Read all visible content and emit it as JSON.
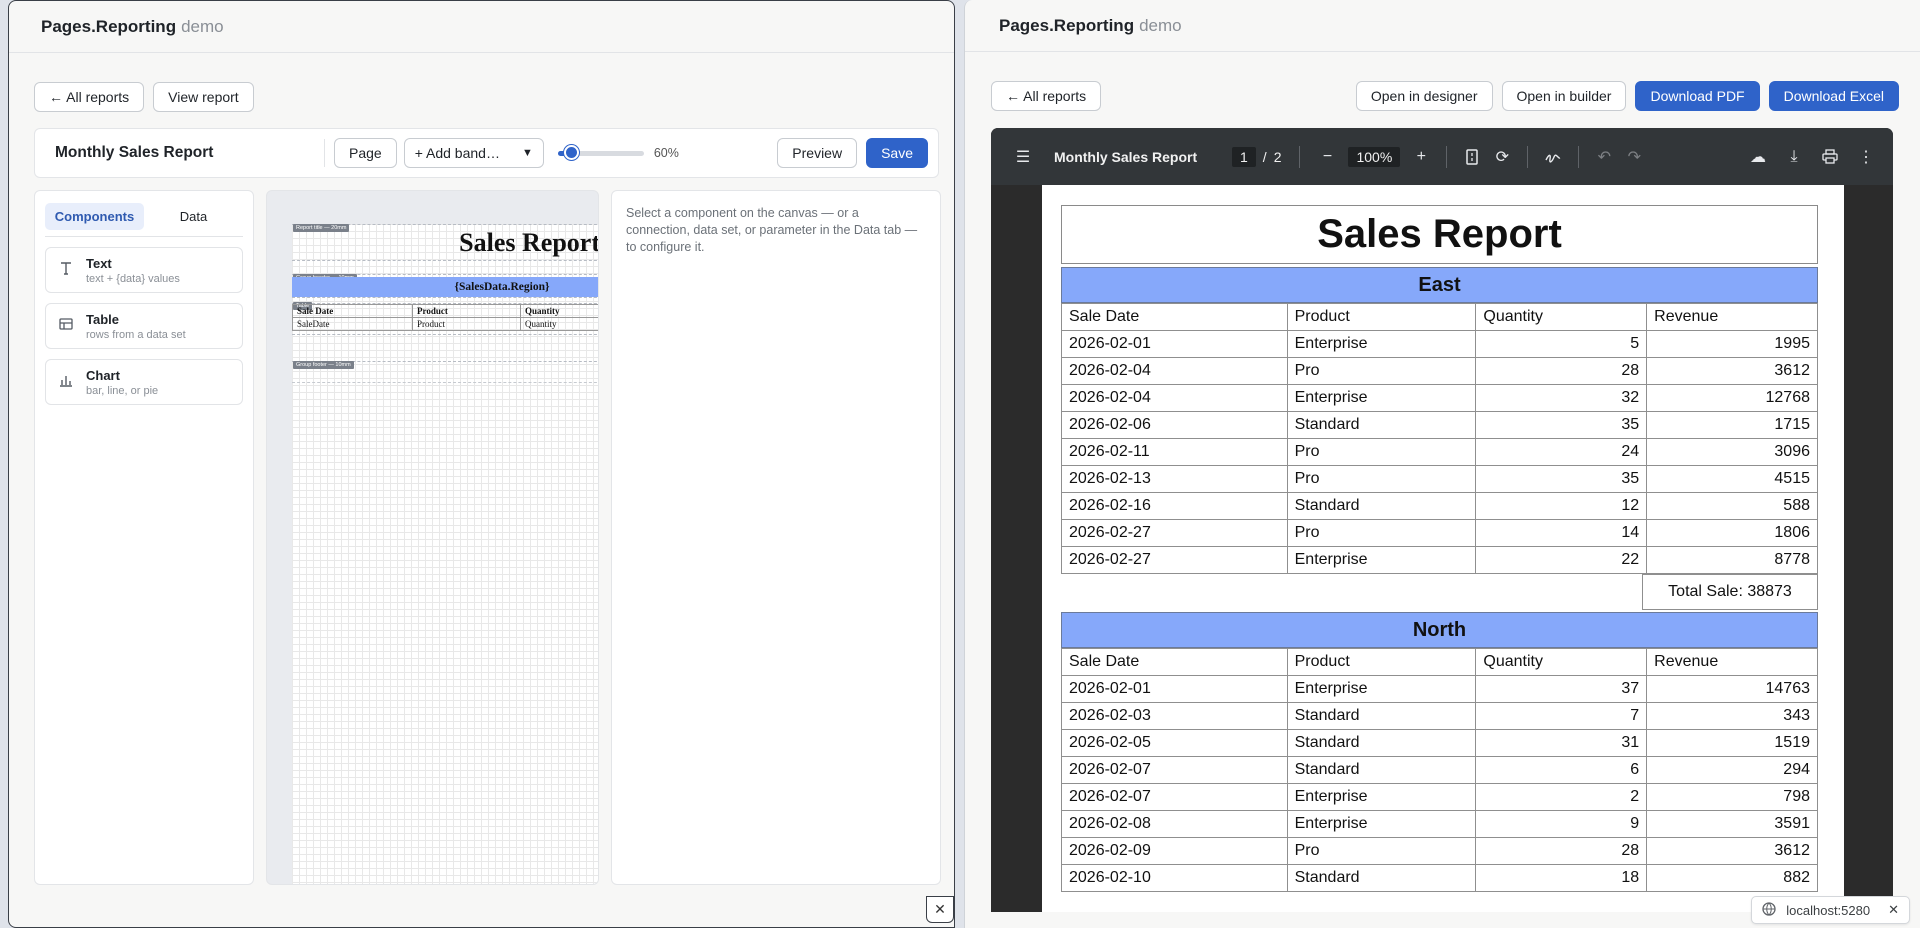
{
  "left": {
    "brand": "Pages.Reporting",
    "brand_suffix": "demo",
    "all_reports": "← All reports",
    "view_report": "View report",
    "toolbar": {
      "title": "Monthly Sales Report",
      "page": "Page",
      "add_band": "+ Add band…",
      "zoom_value": 60,
      "zoom_label": "60%",
      "preview": "Preview",
      "save": "Save"
    },
    "panel": {
      "tabs": [
        "Components",
        "Data"
      ],
      "items": [
        {
          "name": "Text",
          "desc": "text + {data} values",
          "icon": "text-icon"
        },
        {
          "name": "Table",
          "desc": "rows from a data set",
          "icon": "table-icon"
        },
        {
          "name": "Chart",
          "desc": "bar, line, or pie",
          "icon": "chart-icon"
        }
      ]
    },
    "canvas": {
      "title_band": "Report title — 20mm",
      "title_text": "Sales Report",
      "group_header_band": "Group header — 10mm",
      "group_text": "{SalesData.Region}",
      "table_band": "Table",
      "headers": [
        "Sale Date",
        "Product",
        "Quantity"
      ],
      "fields": [
        "SaleDate",
        "Product",
        "Quantity"
      ],
      "group_footer_band": "Group footer — 10mm"
    },
    "hint": "Select a component on the canvas — or a connection, data set, or parameter in the Data tab — to configure it.",
    "close": "✕"
  },
  "right": {
    "brand": "Pages.Reporting",
    "brand_suffix": "demo",
    "all_reports": "← All reports",
    "open_designer": "Open in designer",
    "open_builder": "Open in builder",
    "download_pdf": "Download PDF",
    "download_excel": "Download Excel",
    "viewer": {
      "title": "Monthly Sales Report",
      "page": "1",
      "page_sep": "/",
      "pages": "2",
      "zoom": "100%"
    },
    "report": {
      "title": "Sales Report",
      "columns": [
        "Sale Date",
        "Product",
        "Quantity",
        "Revenue"
      ],
      "groups": [
        {
          "region": "East",
          "rows": [
            [
              "2026-02-01",
              "Enterprise",
              "5",
              "1995"
            ],
            [
              "2026-02-04",
              "Pro",
              "28",
              "3612"
            ],
            [
              "2026-02-04",
              "Enterprise",
              "32",
              "12768"
            ],
            [
              "2026-02-06",
              "Standard",
              "35",
              "1715"
            ],
            [
              "2026-02-11",
              "Pro",
              "24",
              "3096"
            ],
            [
              "2026-02-13",
              "Pro",
              "35",
              "4515"
            ],
            [
              "2026-02-16",
              "Standard",
              "12",
              "588"
            ],
            [
              "2026-02-27",
              "Pro",
              "14",
              "1806"
            ],
            [
              "2026-02-27",
              "Enterprise",
              "22",
              "8778"
            ]
          ],
          "total": "Total Sale: 38873"
        },
        {
          "region": "North",
          "rows": [
            [
              "2026-02-01",
              "Enterprise",
              "37",
              "14763"
            ],
            [
              "2026-02-03",
              "Standard",
              "7",
              "343"
            ],
            [
              "2026-02-05",
              "Standard",
              "31",
              "1519"
            ],
            [
              "2026-02-07",
              "Standard",
              "6",
              "294"
            ],
            [
              "2026-02-07",
              "Enterprise",
              "2",
              "798"
            ],
            [
              "2026-02-08",
              "Enterprise",
              "9",
              "3591"
            ],
            [
              "2026-02-09",
              "Pro",
              "28",
              "3612"
            ],
            [
              "2026-02-10",
              "Standard",
              "18",
              "882"
            ]
          ]
        }
      ]
    },
    "url": "localhost:5280",
    "close": "✕"
  },
  "colors": {
    "accent": "#2f63c9",
    "region_fill": "#86a8fa",
    "viewer_bar": "#323639"
  }
}
